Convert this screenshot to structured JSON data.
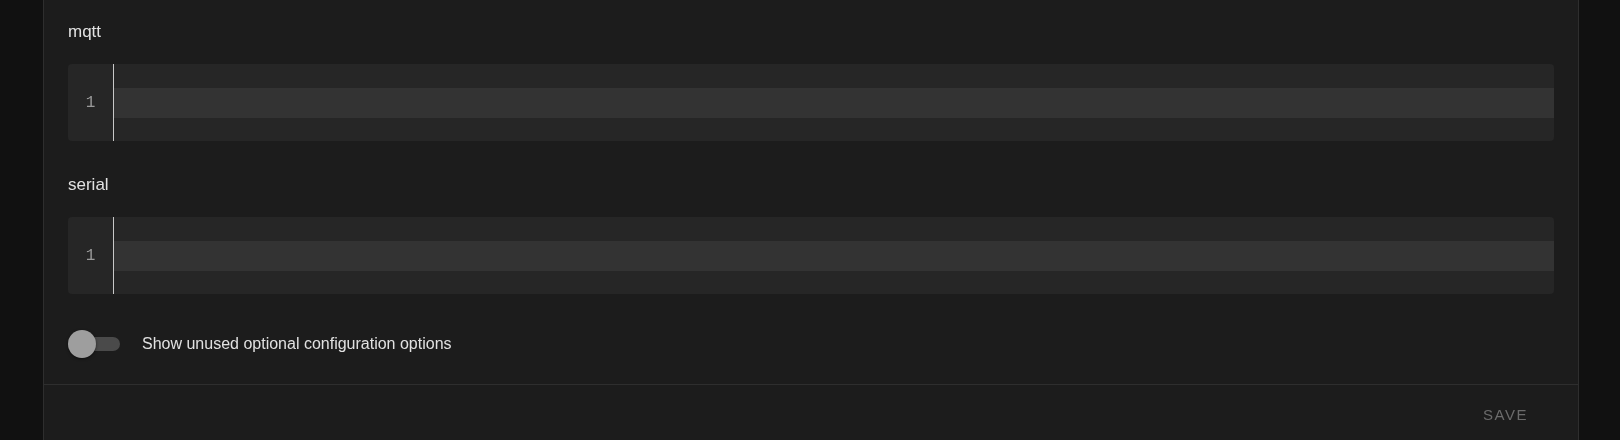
{
  "editors": [
    {
      "label": "mqtt",
      "line_numbers": [
        "1"
      ]
    },
    {
      "label": "serial",
      "line_numbers": [
        "1"
      ]
    }
  ],
  "toggle": {
    "label": "Show unused optional configuration options",
    "on": false
  },
  "actions": {
    "save": {
      "label": "SAVE",
      "disabled": true
    }
  }
}
